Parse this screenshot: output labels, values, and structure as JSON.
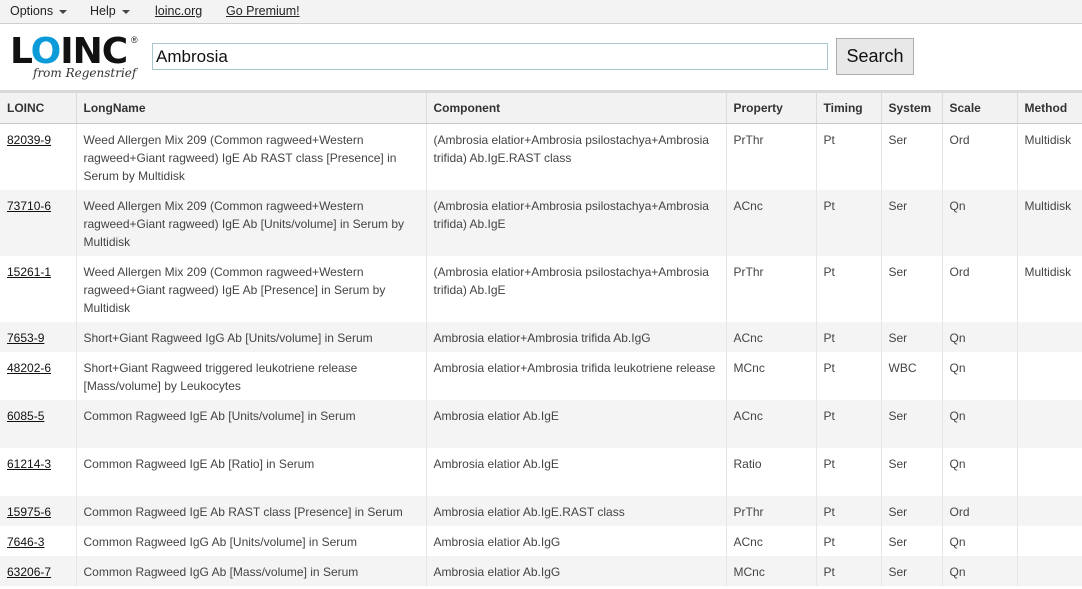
{
  "menu": {
    "options_label": "Options",
    "help_label": "Help",
    "loinc_link": "loinc.org",
    "premium_link": "Go Premium!"
  },
  "logo": {
    "word": "LOINC",
    "reg": "®",
    "tagline": "from Regenstrief"
  },
  "search": {
    "value": "Ambrosia",
    "button_label": "Search"
  },
  "columns": [
    "LOINC",
    "LongName",
    "Component",
    "Property",
    "Timing",
    "System",
    "Scale",
    "Method"
  ],
  "rows": [
    {
      "loinc": "82039-9",
      "longname": "Weed Allergen Mix 209 (Common ragweed+Western ragweed+Giant ragweed) IgE Ab RAST class [Presence] in Serum by Multidisk",
      "component": "(Ambrosia elatior+Ambrosia psilostachya+Ambrosia trifida) Ab.IgE.RAST class",
      "property": "PrThr",
      "timing": "Pt",
      "system": "Ser",
      "scale": "Ord",
      "method": "Multidisk"
    },
    {
      "loinc": "73710-6",
      "longname": "Weed Allergen Mix 209 (Common ragweed+Western ragweed+Giant ragweed) IgE Ab [Units/volume] in Serum by Multidisk",
      "component": "(Ambrosia elatior+Ambrosia psilostachya+Ambrosia trifida) Ab.IgE",
      "property": "ACnc",
      "timing": "Pt",
      "system": "Ser",
      "scale": "Qn",
      "method": "Multidisk"
    },
    {
      "loinc": "15261-1",
      "longname": "Weed Allergen Mix 209 (Common ragweed+Western ragweed+Giant ragweed) IgE Ab [Presence] in Serum by Multidisk",
      "component": "(Ambrosia elatior+Ambrosia psilostachya+Ambrosia trifida) Ab.IgE",
      "property": "PrThr",
      "timing": "Pt",
      "system": "Ser",
      "scale": "Ord",
      "method": "Multidisk"
    },
    {
      "loinc": "7653-9",
      "longname": "Short+Giant Ragweed IgG Ab [Units/volume] in Serum",
      "component": "Ambrosia elatior+Ambrosia trifida Ab.IgG",
      "property": "ACnc",
      "timing": "Pt",
      "system": "Ser",
      "scale": "Qn",
      "method": ""
    },
    {
      "loinc": "48202-6",
      "longname": "Short+Giant Ragweed triggered leukotriene release [Mass/volume] by Leukocytes",
      "component": "Ambrosia elatior+Ambrosia trifida leukotriene release",
      "property": "MCnc",
      "timing": "Pt",
      "system": "WBC",
      "scale": "Qn",
      "method": ""
    },
    {
      "loinc": "6085-5",
      "longname": "Common Ragweed IgE Ab [Units/volume] in Serum",
      "component": "Ambrosia elatior Ab.IgE",
      "property": "ACnc",
      "timing": "Pt",
      "system": "Ser",
      "scale": "Qn",
      "method": ""
    },
    {
      "loinc": "61214-3",
      "longname": "Common Ragweed IgE Ab [Ratio] in Serum",
      "component": "Ambrosia elatior Ab.IgE",
      "property": "Ratio",
      "timing": "Pt",
      "system": "Ser",
      "scale": "Qn",
      "method": ""
    },
    {
      "loinc": "15975-6",
      "longname": "Common Ragweed IgE Ab RAST class [Presence] in Serum",
      "component": "Ambrosia elatior Ab.IgE.RAST class",
      "property": "PrThr",
      "timing": "Pt",
      "system": "Ser",
      "scale": "Ord",
      "method": ""
    },
    {
      "loinc": "7646-3",
      "longname": "Common Ragweed IgG Ab [Units/volume] in Serum",
      "component": "Ambrosia elatior Ab.IgG",
      "property": "ACnc",
      "timing": "Pt",
      "system": "Ser",
      "scale": "Qn",
      "method": ""
    },
    {
      "loinc": "63206-7",
      "longname": "Common Ragweed IgG Ab [Mass/volume] in Serum",
      "component": "Ambrosia elatior Ab.IgG",
      "property": "MCnc",
      "timing": "Pt",
      "system": "Ser",
      "scale": "Qn",
      "method": ""
    }
  ]
}
